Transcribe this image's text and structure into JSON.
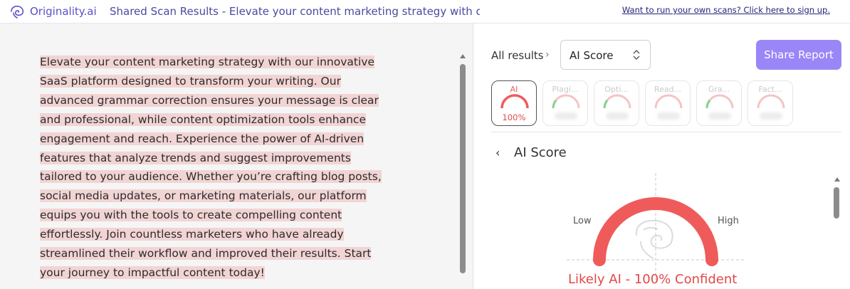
{
  "brand": {
    "name": "Originality.ai",
    "color": "#5b4fc9"
  },
  "header": {
    "title": "Shared Scan Results - Elevate your content marketing strategy with our i",
    "signup_link": "Want to run your own scans? Click here to sign up."
  },
  "document": {
    "lines": [
      "Elevate your content marketing strategy with our innovative",
      "SaaS platform designed to transform your writing. Our",
      "advanced grammar correction ensures your message is clear",
      "and professional, while content optimization tools enhance",
      "engagement and reach. Experience the power of AI-driven",
      "features that analyze trends and suggest improvements",
      "tailored to your audience. Whether you’re crafting blog posts,",
      "social media updates, or marketing materials, our platform",
      "equips you with the tools to create compelling content",
      "effortlessly. Join countless marketers who have already",
      "streamlined their workflow and improved their results. Start",
      "your journey to impactful content today!"
    ],
    "highlight_color": "#f2d4d4"
  },
  "results": {
    "breadcrumb": "All results",
    "selected_view": "AI Score",
    "share_label": "Share Report",
    "share_color": "#9a86f7",
    "tabs": [
      {
        "label": "AI",
        "value": "100%",
        "active": true
      },
      {
        "label": "Plagi...",
        "value": "",
        "active": false
      },
      {
        "label": "Opti...",
        "value": "",
        "active": false
      },
      {
        "label": "Read...",
        "value": "",
        "active": false
      },
      {
        "label": "Gra...",
        "value": "",
        "active": false
      },
      {
        "label": "Fact...",
        "value": "",
        "active": false
      }
    ],
    "section_title": "AI Score",
    "gauge": {
      "low_label": "Low",
      "high_label": "High",
      "fraction": 1.0,
      "color": "#ef5b5b"
    },
    "verdict": "Likely AI - 100% Confident"
  }
}
